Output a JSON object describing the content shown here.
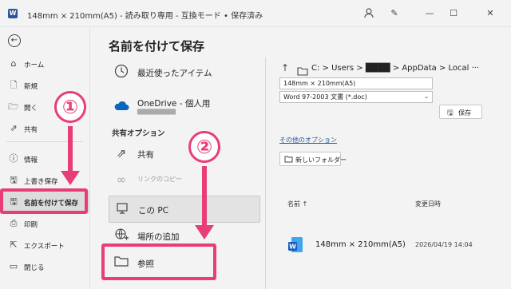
{
  "titlebar": {
    "title": "148mm × 210mm(A5)  -  読み取り専用  -  互換モード • 保存済み"
  },
  "nav": {
    "items": [
      {
        "label": "ホーム",
        "icon": "home-icon"
      },
      {
        "label": "新規",
        "icon": "new-document-icon"
      },
      {
        "label": "開く",
        "icon": "folder-open-icon"
      },
      {
        "label": "共有",
        "icon": "share-icon"
      },
      {
        "label": "情報",
        "icon": "info-icon"
      },
      {
        "label": "上書き保存",
        "icon": "save-icon"
      },
      {
        "label": "名前を付けて保存",
        "icon": "save-as-icon"
      },
      {
        "label": "印刷",
        "icon": "print-icon"
      },
      {
        "label": "エクスポート",
        "icon": "export-icon"
      },
      {
        "label": "閉じる",
        "icon": "close-folder-icon"
      }
    ]
  },
  "main": {
    "heading": "名前を付けて保存",
    "recent_label": "最近使ったアイテム",
    "onedrive_label": "OneDrive - 個人用",
    "onedrive_account": "█████████████",
    "shared_section": "共有オプション",
    "share_label": "共有",
    "copy_link_label": "リンクのコピー",
    "this_pc_label": "この PC",
    "add_place_label": "場所の追加",
    "browse_label": "参照"
  },
  "right": {
    "path": "C: > Users > ████ > AppData > Local ···",
    "filename": "148mm × 210mm(A5)",
    "filetype": "Word 97-2003 文書 (*.doc)",
    "save_label": "保存",
    "more_options": "その他のオプション",
    "new_folder": "新しいフォルダー",
    "col_name": "名前 ↑",
    "col_date": "変更日時",
    "files": [
      {
        "name": "148mm × 210mm(A5)",
        "date": "2026/04/19 14:04"
      }
    ]
  },
  "annotations": {
    "step1": "①",
    "step2": "②",
    "accent": "#e83e77"
  }
}
